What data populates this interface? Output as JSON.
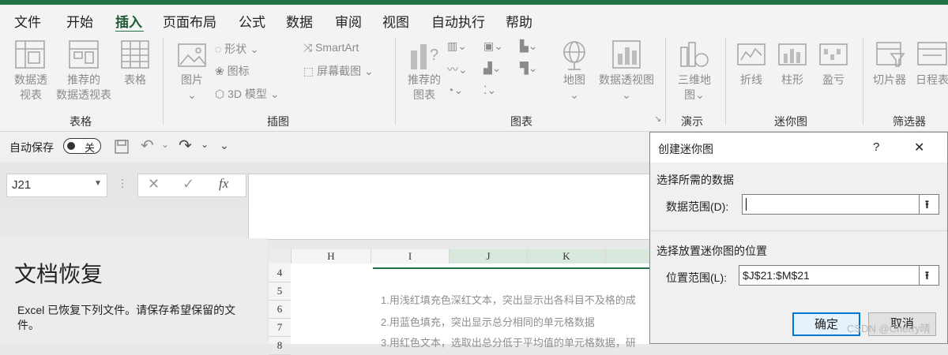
{
  "menu": {
    "items": [
      "文件",
      "开始",
      "插入",
      "页面布局",
      "公式",
      "数据",
      "审阅",
      "视图",
      "自动执行",
      "帮助"
    ],
    "active_index": 2
  },
  "ribbon": {
    "groups": {
      "tables": {
        "label": "表格",
        "pivot_table_l1": "数据透",
        "pivot_table_l2": "视表",
        "recommended_pivot_l1": "推荐的",
        "recommended_pivot_l2": "数据透视表",
        "table": "表格"
      },
      "illustrations": {
        "label": "插图",
        "picture": "图片",
        "shapes": "形状",
        "icons": "图标",
        "models3d": "3D 模型",
        "smartart": "SmartArt",
        "screenshot": "屏幕截图"
      },
      "charts": {
        "label": "图表",
        "recommended_l1": "推荐的",
        "recommended_l2": "图表",
        "maps": "地图",
        "pivot_chart": "数据透视图"
      },
      "tours": {
        "label": "演示",
        "map3d_l1": "三维地",
        "map3d_l2": "图"
      },
      "sparklines": {
        "label": "迷你图",
        "line": "折线",
        "column": "柱形",
        "win_loss": "盈亏"
      },
      "filters": {
        "label": "筛选器",
        "slicer": "切片器",
        "timeline": "日程表"
      }
    }
  },
  "qat": {
    "autosave_label": "自动保存",
    "toggle_state": "关"
  },
  "formula_bar": {
    "name_box": "J21",
    "fx": "fx"
  },
  "doc_recovery": {
    "title": "文档恢复",
    "message": "Excel 已恢复下列文件。请保存希望保留的文件。"
  },
  "grid": {
    "columns": [
      "H",
      "I",
      "J",
      "K"
    ],
    "rows": [
      "4",
      "5",
      "6",
      "7",
      "8"
    ],
    "lines": [
      "1.用浅红填充色深红文本，突出显示出各科目不及格的成",
      "2.用蓝色填充，突出显示总分相同的单元格数据",
      "3.用红色文本，选取出总分低于平均值的单元格数据，研"
    ]
  },
  "dialog": {
    "title": "创建迷你图",
    "help": "?",
    "close": "✕",
    "section1": "选择所需的数据",
    "data_range_label": "数据范围(D):",
    "data_range_value": "",
    "section2": "选择放置迷你图的位置",
    "location_label": "位置范围(L):",
    "location_value": "$J$21:$M$21",
    "ok": "确定",
    "cancel": "取消"
  },
  "watermark": "CSDN @Cherry晴"
}
